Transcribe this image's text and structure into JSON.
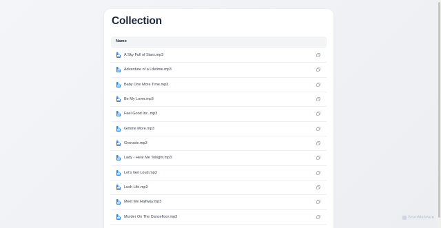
{
  "page": {
    "title": "Collection",
    "table_header": "Name",
    "files": [
      {
        "name": "A Sky Full of Stars.mp3"
      },
      {
        "name": "Adventure of a Lifetime.mp3"
      },
      {
        "name": "Baby One More Time.mp3"
      },
      {
        "name": "Be My Lover.mp3"
      },
      {
        "name": "Feel Good Inc..mp3"
      },
      {
        "name": "Gimme More.mp3"
      },
      {
        "name": "Grenade.mp3"
      },
      {
        "name": "Lady - Hear Me Tonight.mp3"
      },
      {
        "name": "Let's Get Loud.mp3"
      },
      {
        "name": "Lush Life.mp3"
      },
      {
        "name": "Meet Me Halfway.mp3"
      },
      {
        "name": "Murder On The Dancefloor.mp3"
      }
    ],
    "row_icon": "file-icon",
    "row_action_icon": "copy-icon"
  },
  "watermark": {
    "text": "ScanMalware",
    "icon": "scanmalware-logo-icon"
  },
  "colors": {
    "accent": "#2f86d9",
    "title": "#1e2a3b",
    "header_bg": "#f3f4f6"
  }
}
